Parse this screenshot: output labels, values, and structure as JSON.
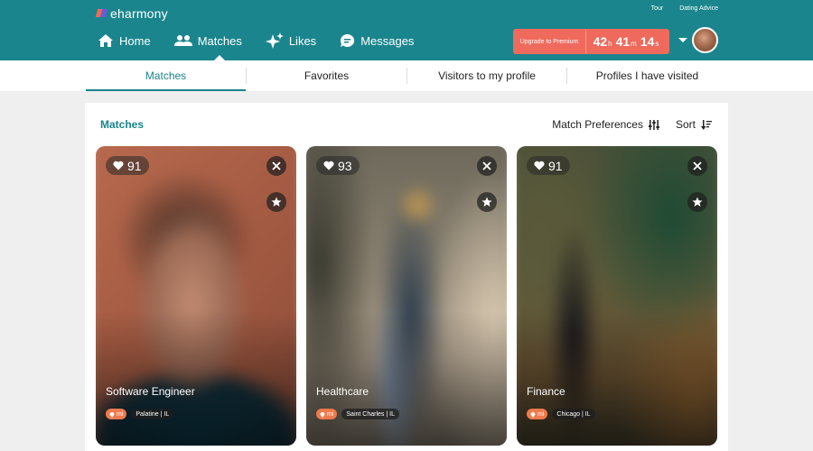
{
  "brand": {
    "name": "eharmony"
  },
  "top_links": [
    "Tour",
    "Dating Advice"
  ],
  "nav": [
    {
      "label": "Home",
      "icon": "home-icon"
    },
    {
      "label": "Matches",
      "icon": "people-icon",
      "active": true
    },
    {
      "label": "Likes",
      "icon": "sparkle-icon"
    },
    {
      "label": "Messages",
      "icon": "chat-icon"
    }
  ],
  "upgrade": {
    "label": "Upgrade to Premium",
    "hours": "42",
    "hours_unit": "h",
    "minutes": "41",
    "minutes_unit": "m",
    "seconds": "14",
    "seconds_unit": "s"
  },
  "tabs": [
    {
      "label": "Matches",
      "active": true
    },
    {
      "label": "Favorites"
    },
    {
      "label": "Visitors to my profile"
    },
    {
      "label": "Profiles I have visited"
    }
  ],
  "section": {
    "title": "Matches",
    "match_preferences": "Match Preferences",
    "sort": "Sort"
  },
  "cards": [
    {
      "score": "91",
      "job": "Software Engineer",
      "distance_unit": "mi",
      "location": "Palatine | IL"
    },
    {
      "score": "93",
      "job": "Healthcare",
      "distance_unit": "mi",
      "location": "Saint Charles | IL"
    },
    {
      "score": "91",
      "job": "Finance",
      "distance_unit": "mi",
      "location": "Chicago | IL"
    }
  ],
  "colors": {
    "brand": "#1a858c",
    "upgrade": "#ef6a5c",
    "tag": "#ef7a4c"
  }
}
